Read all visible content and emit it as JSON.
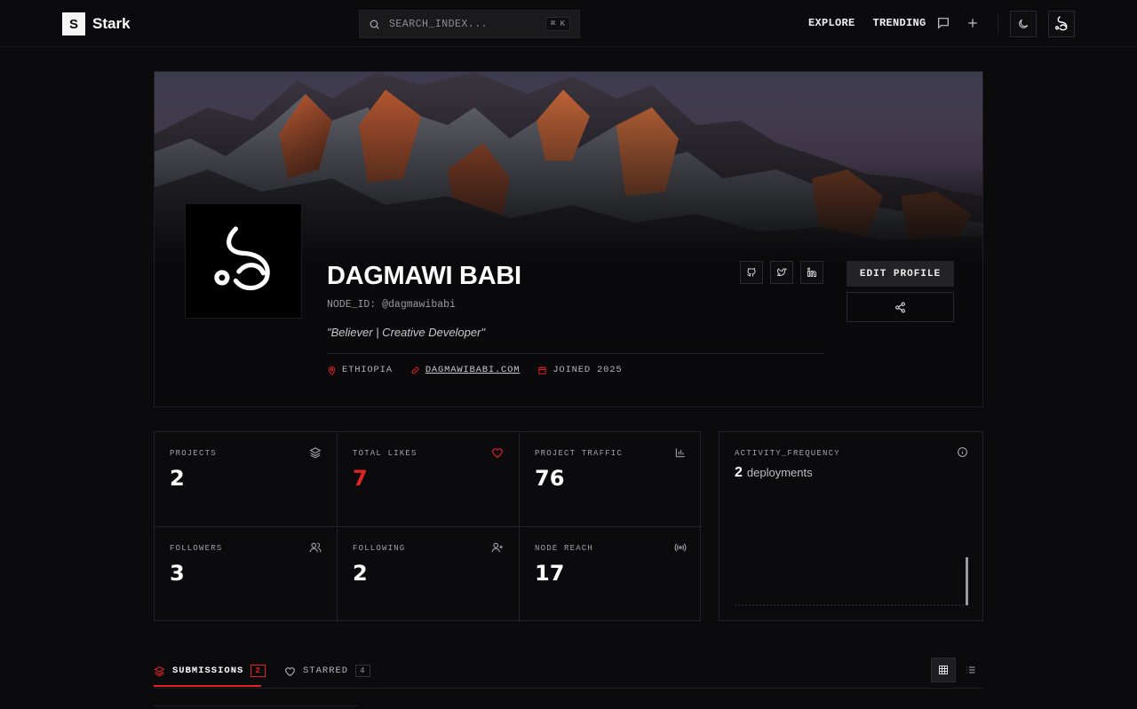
{
  "nav": {
    "brand_initial": "S",
    "brand_name": "Stark",
    "search_placeholder": "SEARCH_INDEX...",
    "search_shortcut": "⌘ K",
    "links": [
      "EXPLORE",
      "TRENDING"
    ]
  },
  "profile": {
    "name": "DAGMAWI BABI",
    "node_id": "NODE_ID: @dagmawibabi",
    "bio": "\"Believer | Creative Developer\"",
    "location": "ETHIOPIA",
    "website": "DAGMAWIBABI.COM",
    "joined": "JOINED 2025",
    "edit_label": "EDIT PROFILE"
  },
  "stats": [
    {
      "label": "PROJECTS",
      "value": "2",
      "icon": "layers-icon"
    },
    {
      "label": "TOTAL LIKES",
      "value": "7",
      "icon": "heart-icon"
    },
    {
      "label": "PROJECT TRAFFIC",
      "value": "76",
      "icon": "bar-chart-icon"
    },
    {
      "label": "FOLLOWERS",
      "value": "3",
      "icon": "users-icon"
    },
    {
      "label": "FOLLOWING",
      "value": "2",
      "icon": "user-plus-icon"
    },
    {
      "label": "NODE REACH",
      "value": "17",
      "icon": "broadcast-icon"
    }
  ],
  "activity": {
    "label": "ACTIVITY_FREQUENCY",
    "count": "2",
    "unit": "deployments"
  },
  "tabs": [
    {
      "label": "SUBMISSIONS",
      "count": "2"
    },
    {
      "label": "STARRED",
      "count": "4"
    }
  ],
  "colors": {
    "accent": "#e02424",
    "background": "#0b0b0d"
  }
}
